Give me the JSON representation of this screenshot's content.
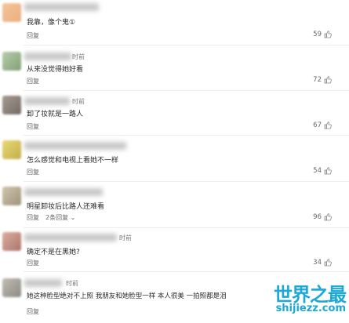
{
  "comments": [
    {
      "text": "我靠，像个鬼①",
      "reply": "回复",
      "likes": "59",
      "time": "",
      "more": "",
      "avatar_color": "#f0c89a"
    },
    {
      "text": "从来没觉得她好看",
      "reply": "回复",
      "likes": "72",
      "time": "时前",
      "more": "",
      "avatar_color": "#9bbf8f"
    },
    {
      "text": "卸了妆就是一路人",
      "reply": "回复",
      "likes": "67",
      "time": "时前",
      "more": "",
      "avatar_color": "#8a7f78"
    },
    {
      "text": "怎么感觉和电视上看她不一样",
      "reply": "回复",
      "likes": "54",
      "time": "",
      "more": "",
      "avatar_color": "#d9c64a"
    },
    {
      "text": "明星卸妆后比路人还难看",
      "reply": "回复",
      "likes": "96",
      "time": "",
      "more": "2条回复",
      "avatar_color": "#b8a98a"
    },
    {
      "text": "确定不是在黑她?",
      "reply": "回复",
      "likes": "34",
      "time": "时前",
      "more": "",
      "avatar_color": "#c98d7c"
    },
    {
      "text": "她这种脸型绝对不上照 我朋友和她脸型一样 本人很美 一拍照都是泪",
      "reply": "回复",
      "likes": "",
      "time": "时前",
      "more": "",
      "avatar_color": "#a7a39a"
    }
  ],
  "watermark": {
    "title": "世界之最",
    "url": "shijiezz.com",
    "color": "#1da9d6"
  }
}
